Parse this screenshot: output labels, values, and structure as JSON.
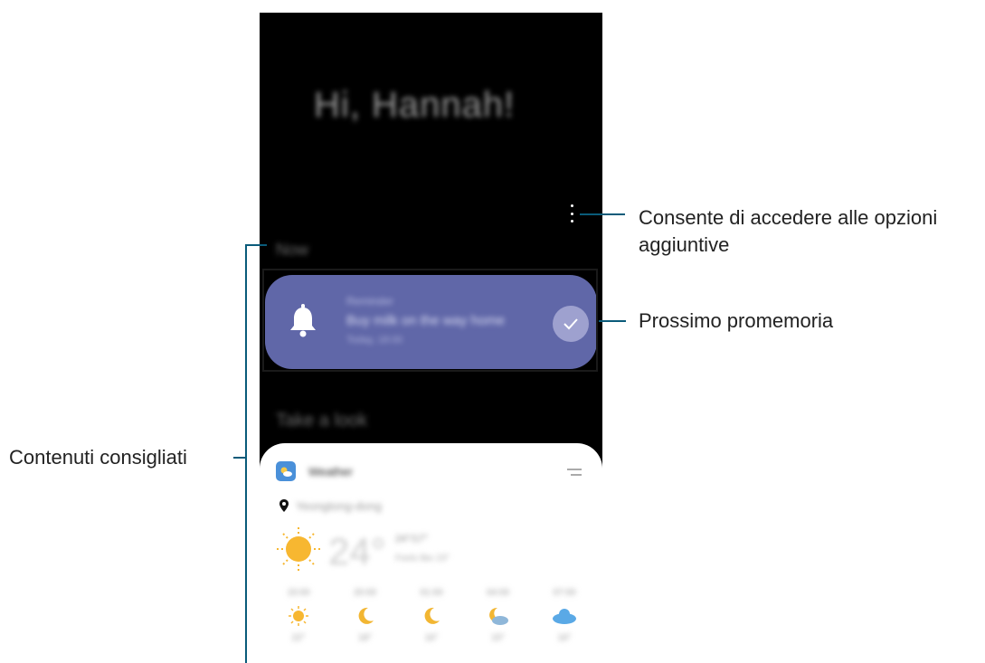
{
  "annotations": {
    "options_line1": "Consente di accedere alle opzioni",
    "options_line2": "aggiuntive",
    "reminder": "Prossimo promemoria",
    "content": "Contenuti consigliati"
  },
  "screen": {
    "greeting": "Hi, Hannah!",
    "section_now": "Now",
    "section_take_a_look": "Take a look"
  },
  "reminder_card": {
    "title": "Reminder",
    "text": "Buy milk on the way home",
    "time": "Today, 18:00",
    "accent_color": "#6067a8"
  },
  "weather_card": {
    "title": "Weather",
    "location": "Yeongtong-dong",
    "temperature": "24°",
    "condition": "24°/17°",
    "feels_like": "Feels like 23°",
    "forecast": [
      {
        "time": "15:00",
        "icon": "sun-icon",
        "temp": "22°"
      },
      {
        "time": "20:00",
        "icon": "moon-icon",
        "temp": "18°"
      },
      {
        "time": "01:00",
        "icon": "moon-icon",
        "temp": "16°"
      },
      {
        "time": "04:00",
        "icon": "moon-cloud-icon",
        "temp": "15°"
      },
      {
        "time": "07:00",
        "icon": "cloud-icon",
        "temp": "16°"
      }
    ]
  }
}
